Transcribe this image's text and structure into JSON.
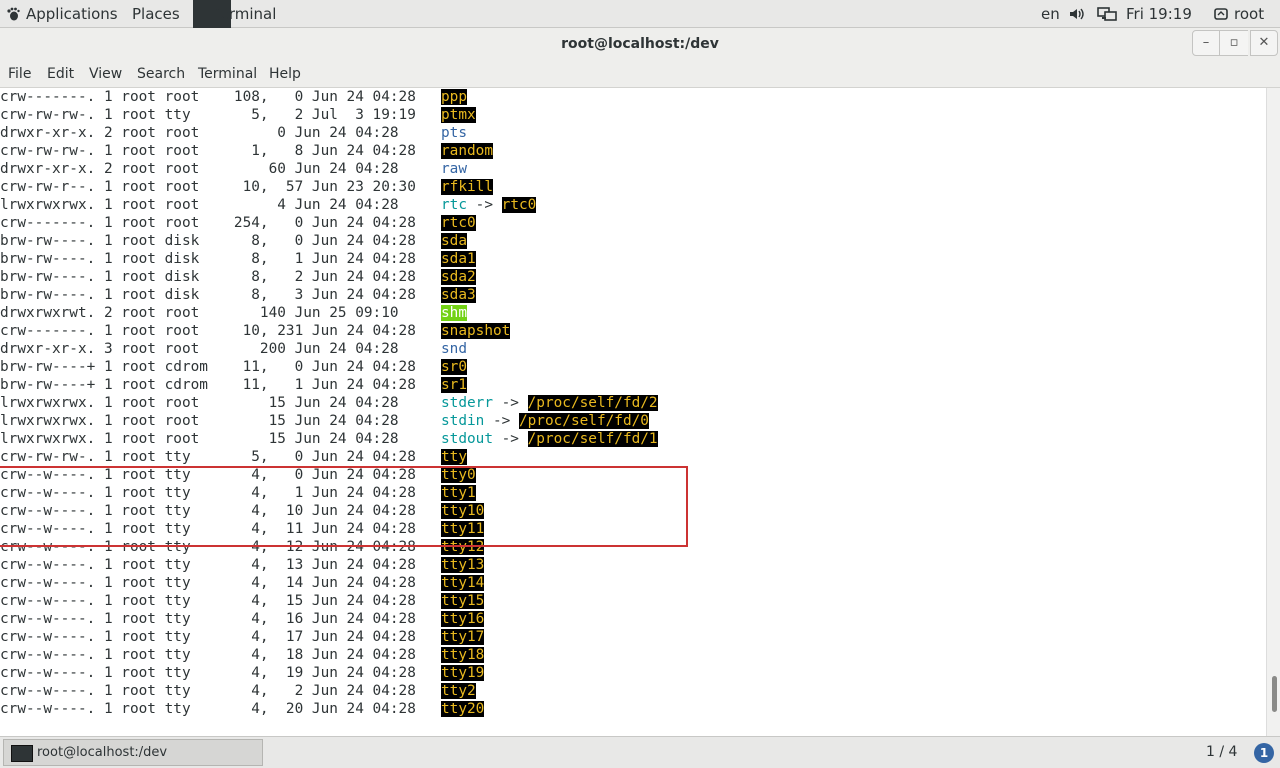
{
  "top_panel": {
    "applications": "Applications",
    "places": "Places",
    "task": "Terminal",
    "lang": "en",
    "clock": "Fri 19:19",
    "user": "root"
  },
  "window": {
    "title": "root@localhost:/dev",
    "minimize": "–",
    "maximize": "▫",
    "close": "✕"
  },
  "menu": {
    "file": "File",
    "edit": "Edit",
    "view": "View",
    "search": "Search",
    "terminal": "Terminal",
    "help": "Help"
  },
  "terminal_lines": [
    {
      "meta": "crw-------. 1 root root    108,   0 Jun 24 04:28",
      "name": "ppp",
      "style": "hl"
    },
    {
      "meta": "crw-rw-rw-. 1 root tty       5,   2 Jul  3 19:19",
      "name": "ptmx",
      "style": "hl"
    },
    {
      "meta": "drwxr-xr-x. 2 root root         0 Jun 24 04:28",
      "name": "pts",
      "style": "dir"
    },
    {
      "meta": "crw-rw-rw-. 1 root root      1,   8 Jun 24 04:28",
      "name": "random",
      "style": "hl"
    },
    {
      "meta": "drwxr-xr-x. 2 root root        60 Jun 24 04:28",
      "name": "raw",
      "style": "dir"
    },
    {
      "meta": "crw-rw-r--. 1 root root     10,  57 Jun 23 20:30",
      "name": "rfkill",
      "style": "hl"
    },
    {
      "meta": "lrwxrwxrwx. 1 root root         4 Jun 24 04:28",
      "name": "rtc",
      "style": "link",
      "arrow": " -> ",
      "target": "rtc0"
    },
    {
      "meta": "crw-------. 1 root root    254,   0 Jun 24 04:28",
      "name": "rtc0",
      "style": "hl"
    },
    {
      "meta": "brw-rw----. 1 root disk      8,   0 Jun 24 04:28",
      "name": "sda",
      "style": "hl"
    },
    {
      "meta": "brw-rw----. 1 root disk      8,   1 Jun 24 04:28",
      "name": "sda1",
      "style": "hl"
    },
    {
      "meta": "brw-rw----. 1 root disk      8,   2 Jun 24 04:28",
      "name": "sda2",
      "style": "hl"
    },
    {
      "meta": "brw-rw----. 1 root disk      8,   3 Jun 24 04:28",
      "name": "sda3",
      "style": "hl"
    },
    {
      "meta": "drwxrwxrwt. 2 root root       140 Jun 25 09:10",
      "name": "shm",
      "style": "hl-green"
    },
    {
      "meta": "crw-------. 1 root root     10, 231 Jun 24 04:28",
      "name": "snapshot",
      "style": "hl"
    },
    {
      "meta": "drwxr-xr-x. 3 root root       200 Jun 24 04:28",
      "name": "snd",
      "style": "dir"
    },
    {
      "meta": "brw-rw----+ 1 root cdrom    11,   0 Jun 24 04:28",
      "name": "sr0",
      "style": "hl"
    },
    {
      "meta": "brw-rw----+ 1 root cdrom    11,   1 Jun 24 04:28",
      "name": "sr1",
      "style": "hl"
    },
    {
      "meta": "lrwxrwxrwx. 1 root root        15 Jun 24 04:28",
      "name": "stderr",
      "style": "link",
      "arrow": " -> ",
      "target": "/proc/self/fd/2"
    },
    {
      "meta": "lrwxrwxrwx. 1 root root        15 Jun 24 04:28",
      "name": "stdin",
      "style": "link",
      "arrow": " -> ",
      "target": "/proc/self/fd/0"
    },
    {
      "meta": "lrwxrwxrwx. 1 root root        15 Jun 24 04:28",
      "name": "stdout",
      "style": "link",
      "arrow": " -> ",
      "target": "/proc/self/fd/1"
    },
    {
      "meta": "crw-rw-rw-. 1 root tty       5,   0 Jun 24 04:28",
      "name": "tty",
      "style": "hl"
    },
    {
      "meta": "crw--w----. 1 root tty       4,   0 Jun 24 04:28",
      "name": "tty0",
      "style": "hl"
    },
    {
      "meta": "crw--w----. 1 root tty       4,   1 Jun 24 04:28",
      "name": "tty1",
      "style": "hl"
    },
    {
      "meta": "crw--w----. 1 root tty       4,  10 Jun 24 04:28",
      "name": "tty10",
      "style": "hl"
    },
    {
      "meta": "crw--w----. 1 root tty       4,  11 Jun 24 04:28",
      "name": "tty11",
      "style": "hl"
    },
    {
      "meta": "crw--w----. 1 root tty       4,  12 Jun 24 04:28",
      "name": "tty12",
      "style": "hl"
    },
    {
      "meta": "crw--w----. 1 root tty       4,  13 Jun 24 04:28",
      "name": "tty13",
      "style": "hl"
    },
    {
      "meta": "crw--w----. 1 root tty       4,  14 Jun 24 04:28",
      "name": "tty14",
      "style": "hl"
    },
    {
      "meta": "crw--w----. 1 root tty       4,  15 Jun 24 04:28",
      "name": "tty15",
      "style": "hl"
    },
    {
      "meta": "crw--w----. 1 root tty       4,  16 Jun 24 04:28",
      "name": "tty16",
      "style": "hl"
    },
    {
      "meta": "crw--w----. 1 root tty       4,  17 Jun 24 04:28",
      "name": "tty17",
      "style": "hl"
    },
    {
      "meta": "crw--w----. 1 root tty       4,  18 Jun 24 04:28",
      "name": "tty18",
      "style": "hl"
    },
    {
      "meta": "crw--w----. 1 root tty       4,  19 Jun 24 04:28",
      "name": "tty19",
      "style": "hl"
    },
    {
      "meta": "crw--w----. 1 root tty       4,   2 Jun 24 04:28",
      "name": "tty2",
      "style": "hl"
    },
    {
      "meta": "crw--w----. 1 root tty       4,  20 Jun 24 04:28",
      "name": "tty20",
      "style": "hl"
    }
  ],
  "bottom_panel": {
    "task": "root@localhost:/dev",
    "workspace": "1 / 4",
    "notifications": "1"
  }
}
